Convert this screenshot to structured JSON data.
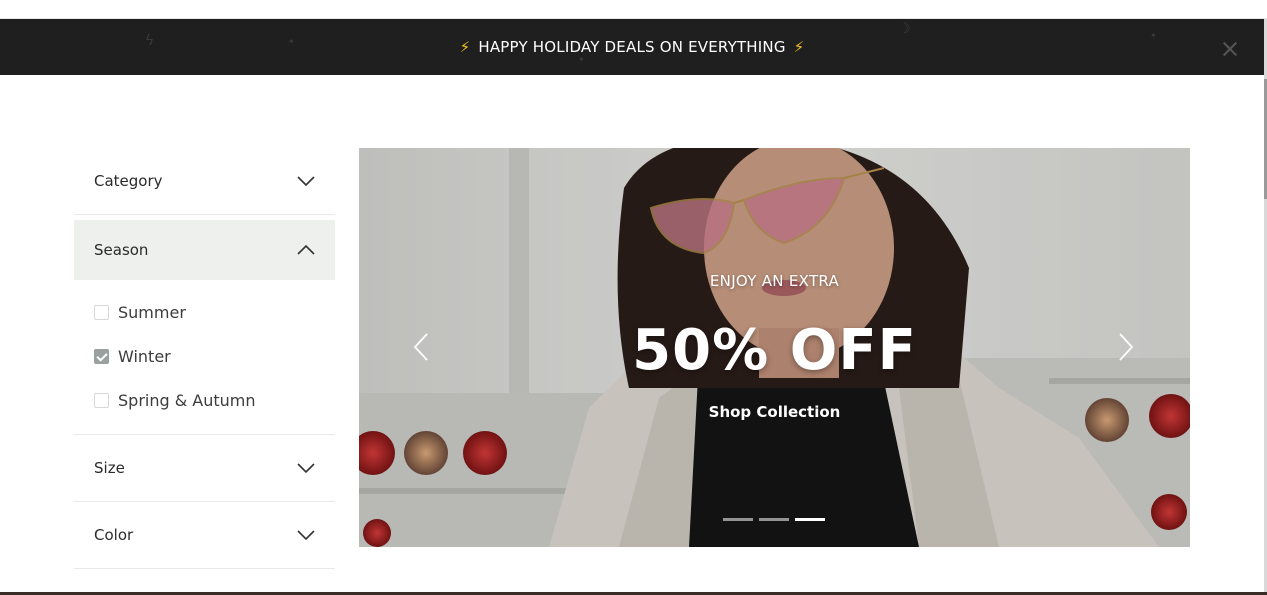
{
  "announcement": {
    "text": "HAPPY HOLIDAY DEALS ON EVERYTHING",
    "bolt": "⚡",
    "close_icon": "close-icon"
  },
  "filters": {
    "groups": [
      {
        "title": "Category",
        "state": "collapsed"
      },
      {
        "title": "Season",
        "state": "expanded",
        "options": [
          {
            "label": "Summer",
            "checked": false
          },
          {
            "label": "Winter",
            "checked": true
          },
          {
            "label": "Spring & Autumn",
            "checked": false
          }
        ]
      },
      {
        "title": "Size",
        "state": "collapsed"
      },
      {
        "title": "Color",
        "state": "collapsed"
      }
    ]
  },
  "hero": {
    "eyebrow": "ENJOY AN EXTRA",
    "headline": "50% OFF",
    "cta": "Shop Collection",
    "slides_total": 3,
    "active_slide": 3
  },
  "colors": {
    "announcement_bg": "#1f1f1f",
    "bolt": "#f2c21b",
    "active_filter_bg": "#eef0ed"
  }
}
